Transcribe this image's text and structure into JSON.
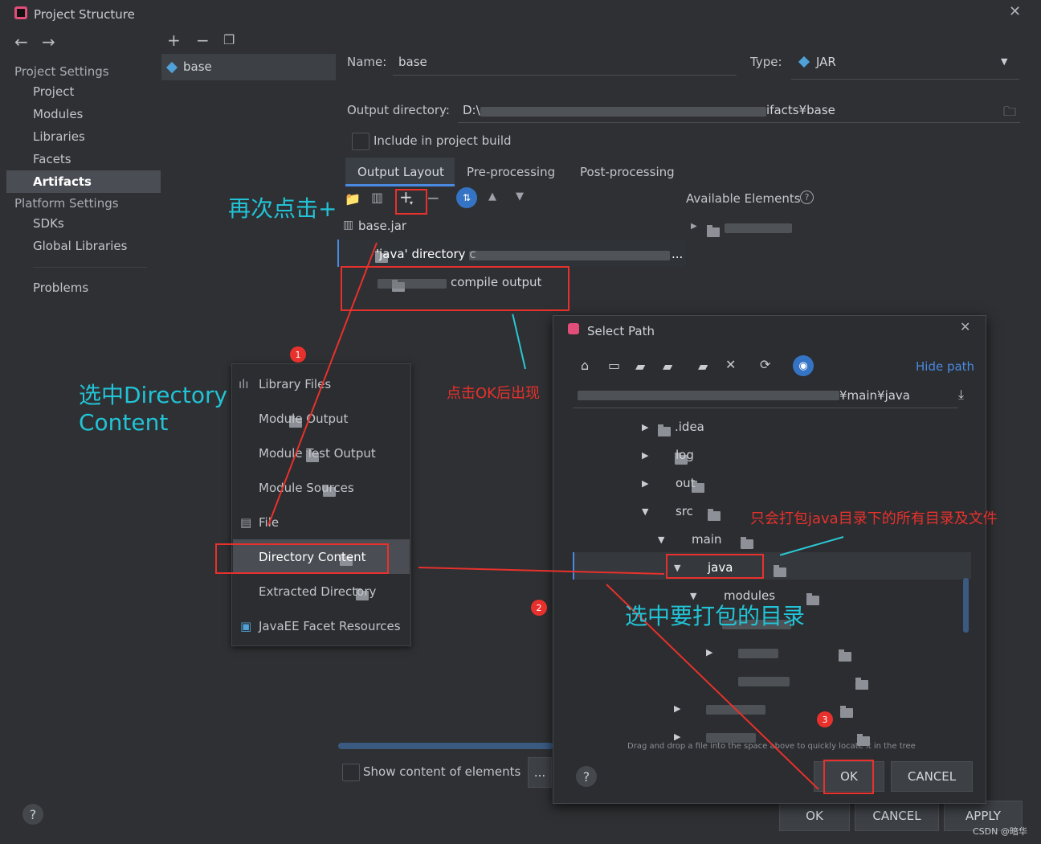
{
  "window": {
    "title": "Project Structure"
  },
  "sidebar": {
    "project_settings": "Project Settings",
    "items_project": [
      "Project",
      "Modules",
      "Libraries",
      "Facets",
      "Artifacts"
    ],
    "platform_settings": "Platform Settings",
    "items_platform": [
      "SDKs",
      "Global Libraries"
    ],
    "problems": "Problems",
    "selected": "Artifacts"
  },
  "artifacts_list": {
    "item": "base"
  },
  "form": {
    "name_label": "Name:",
    "name_value": "base",
    "type_label": "Type:",
    "type_value": "JAR",
    "output_label": "Output directory:",
    "output_value_prefix": "D:\\",
    "output_value_suffix": "ifacts¥base",
    "include_label": "Include in project build"
  },
  "tabs": [
    "Output Layout",
    "Pre-processing",
    "Post-processing"
  ],
  "available_elements": "Available Elements",
  "layout_tree": {
    "root": "base.jar",
    "java_dir": "'java' directory c",
    "java_dir_tail": "...",
    "compile_output": "compile output"
  },
  "popup_menu": [
    "Library Files",
    "Module Output",
    "Module Test Output",
    "Module Sources",
    "File",
    "Directory Content",
    "Extracted Directory",
    "JavaEE Facet Resources"
  ],
  "select_path": {
    "title": "Select Path",
    "hide_path": "Hide path",
    "path_suffix": "¥main¥java",
    "tree": [
      ".idea",
      "log",
      "out",
      "src",
      "main",
      "java",
      "modules"
    ],
    "drag_hint": "Drag and drop a file into the space above to quickly locate it in the tree",
    "ok": "OK",
    "cancel": "CANCEL"
  },
  "bottom": {
    "show_content": "Show content of elements",
    "ellipsis": "...",
    "ok": "OK",
    "cancel": "CANCEL",
    "apply": "APPLY"
  },
  "annotations": {
    "click_again": "再次点击+",
    "select_directory": "选中Directory",
    "select_directory_2": "Content",
    "appears_after_ok": "点击OK后出现",
    "only_java": "只会打包java目录下的所有目录及文件",
    "select_target": "选中要打包的目录",
    "step1": "1",
    "step2": "2",
    "step3": "3"
  },
  "watermark": "CSDN @暗华"
}
